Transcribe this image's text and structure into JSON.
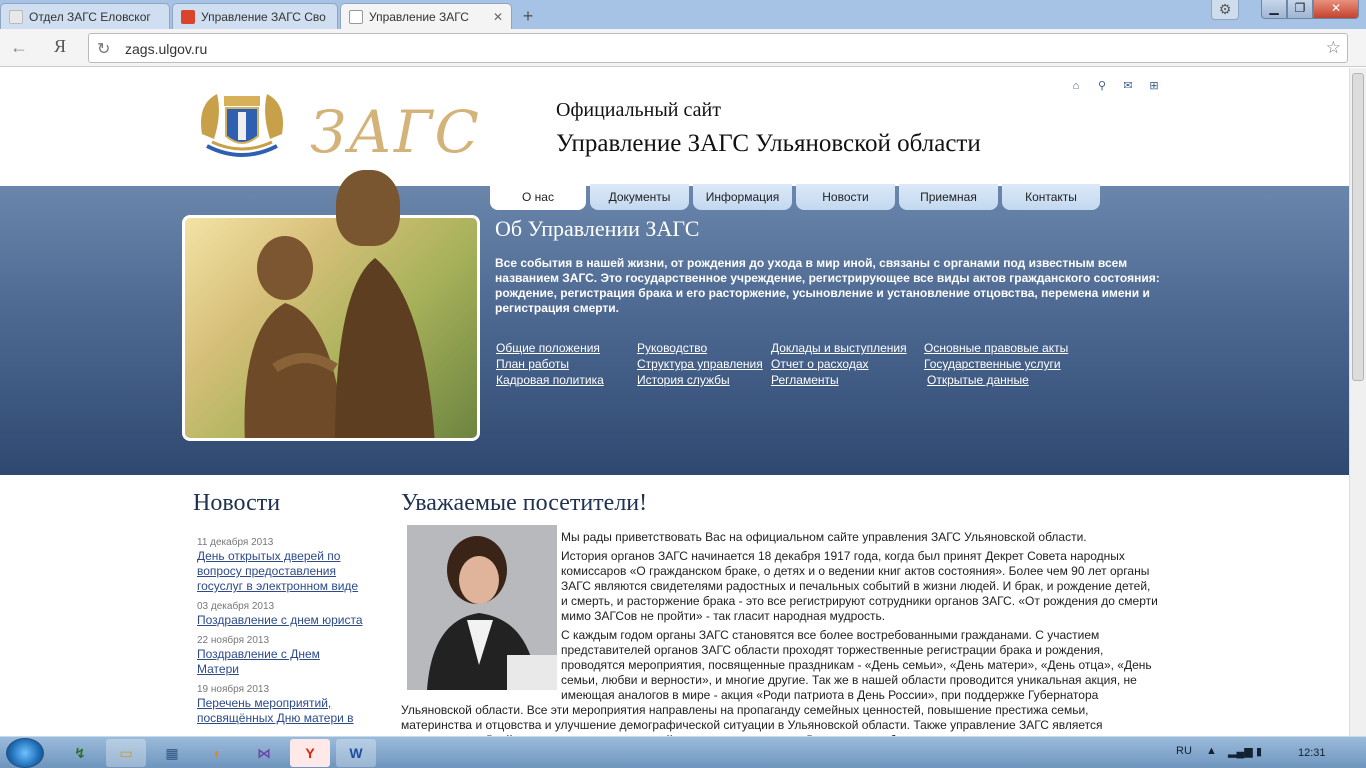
{
  "browser": {
    "tabs": [
      {
        "title": "Отдел ЗАГС Еловског",
        "active": false
      },
      {
        "title": "Управление ЗАГС Сво",
        "active": false
      },
      {
        "title": "Управление ЗАГС",
        "active": true
      }
    ],
    "new_tab": "+",
    "ya_button": "Я",
    "url": "zags.ulgov.ru"
  },
  "header": {
    "subtitle": "Официальный сайт",
    "title": "Управление ЗАГС Ульяновской области",
    "logo_text": "ЗАГС",
    "icons": [
      "home-icon",
      "search-icon",
      "mail-icon",
      "sitemap-icon"
    ]
  },
  "menu": [
    {
      "label": "О нас",
      "active": true
    },
    {
      "label": "Документы",
      "active": false
    },
    {
      "label": "Информация",
      "active": false
    },
    {
      "label": "Новости",
      "active": false
    },
    {
      "label": "Приемная",
      "active": false
    },
    {
      "label": "Контакты",
      "active": false
    }
  ],
  "banner": {
    "title": "Об Управлении ЗАГС",
    "text": "Все события в нашей жизни, от рождения до ухода в мир иной, связаны с органами под известным всем названием ЗАГС. Это государственное учреждение, регистрирующее все виды актов гражданского состояния: рождение, регистрация брака и его расторжение, усыновление и установление отцовства, перемена имени и регистрация смерти.",
    "links": [
      [
        "Общие положения",
        "План работы",
        "Кадровая политика"
      ],
      [
        "Руководство",
        "Структура управления",
        "История службы"
      ],
      [
        "Доклады и выступления",
        "Отчет о расходах",
        "Регламенты"
      ],
      [
        "Основные правовые акты",
        "Государственные услуги",
        "Открытые данные"
      ]
    ]
  },
  "news": {
    "heading": "Новости",
    "items": [
      {
        "date": "11 декабря 2013",
        "title": "День открытых дверей по вопросу предоставления госуслуг в электронном виде"
      },
      {
        "date": "03 декабря 2013",
        "title": "Поздравление с днем юриста"
      },
      {
        "date": "22 ноября 2013",
        "title": "Поздравление с Днем Матери"
      },
      {
        "date": "19 ноября 2013",
        "title": "Перечень мероприятий, посвящённых Дню матери в"
      }
    ]
  },
  "welcome": {
    "heading": "Уважаемые посетители!",
    "paragraphs": [
      "Мы рады приветствовать Вас на официальном сайте управления ЗАГС Ульяновской области.",
      "История органов ЗАГС начинается 18 декабря 1917 года, когда был принят Декрет Совета народных комиссаров «О гражданском браке, о детях и о ведении книг актов состояния». Более чем 90 лет органы ЗАГС являются свидетелями радостных и печальных событий в жизни людей. И брак, и рождение детей, и смерть, и расторжение брака - это все регистрируют сотрудники органов ЗАГС. «От рождения до смерти мимо ЗАГСов не пройти» - так гласит народная мудрость.",
      "С каждым годом органы ЗАГС становятся все более востребованными гражданами. С участием представителей органов ЗАГС области проходят торжественные регистрации брака и рождения, проводятся мероприятия, посвященные праздникам - «День семьи», «День матери», «День отца», «День семьи, любви и верности», и многие другие. Так же в нашей области проводится уникальная акция, не имеющая аналогов в мире - акция «Роди патриота в День России», при поддержке Губернатора Ульяновской области. Все эти мероприятия направлены на пропаганду семейных ценностей, повышение престижа семьи, материнства и отцовства и улучшение демографической ситуации в Ульяновской области. Также управление ЗАГС является инициатором «Дней памяти ушедших поколений», которые проходят на Волжских кладбищах, посвященные памяти по умершим, чьим"
    ]
  },
  "taskbar": {
    "lang": "RU",
    "time": "12:31",
    "word_label": "W"
  }
}
